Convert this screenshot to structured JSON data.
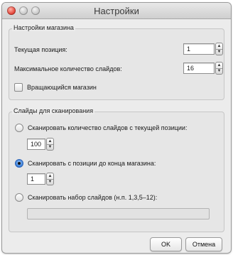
{
  "window": {
    "title": "Настройки"
  },
  "magazine": {
    "group_title": "Настройки магазина",
    "current_position_label": "Текущая позиция:",
    "current_position_value": "1",
    "max_slides_label": "Максимальное количество слайдов:",
    "max_slides_value": "16",
    "rotating_label": "Вращающийся магазин",
    "rotating_checked": false
  },
  "scan": {
    "group_title": "Слайды для сканирования",
    "option1_label": "Сканировать количество слайдов с текущей позиции:",
    "option1_value": "100",
    "option2_label": "Сканировать с позиции до конца магазина:",
    "option2_value": "1",
    "option3_label": "Сканировать набор слайдов (н.п. 1,3,5–12):",
    "option3_value": "",
    "selected_option": 2
  },
  "buttons": {
    "ok": "OK",
    "cancel": "Отмена"
  },
  "icons": {
    "close": "close-icon",
    "minimize": "minimize-icon",
    "zoom": "zoom-icon",
    "stepper_up": "chevron-up-icon",
    "stepper_down": "chevron-down-icon"
  },
  "colors": {
    "accent": "#3a7fd8",
    "close_button": "#e5473b"
  }
}
